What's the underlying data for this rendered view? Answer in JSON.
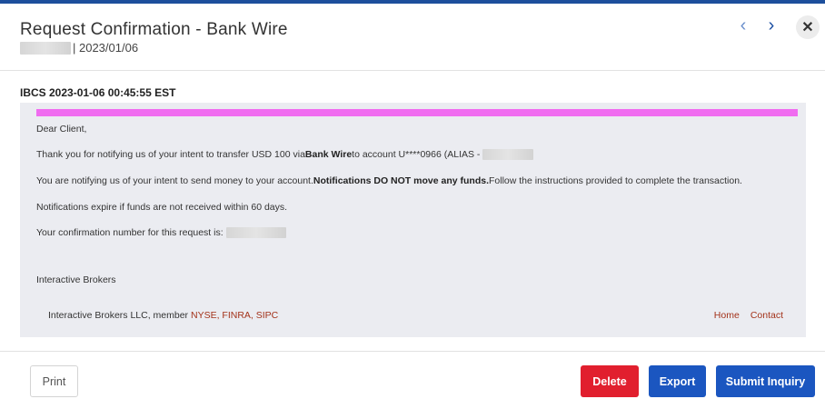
{
  "header": {
    "title": "Request Confirmation - Bank Wire",
    "date": "| 2023/01/06"
  },
  "message": {
    "heading": "IBCS 2023-01-06 00:45:55 EST",
    "greeting": "Dear Client,",
    "line1_pre": "Thank you for notifying us of your intent to transfer USD 100 via ",
    "line1_bold": "Bank Wire",
    "line1_post": " to account U****0966 (ALIAS -",
    "line2_pre": "You are notifying us of your intent to send money to your account. ",
    "line2_bold": "Notifications DO NOT move any funds.",
    "line2_post": " Follow the instructions provided to complete the transaction.",
    "line3": "Notifications expire if funds are not received within 60 days.",
    "line4": "Your confirmation number for this request is:",
    "signature": "Interactive Brokers",
    "footer_pre": "Interactive Brokers LLC, member ",
    "footer_red": "NYSE, FINRA, SIPC",
    "link_home": "Home",
    "link_contact": "Contact"
  },
  "actions": {
    "print": "Print",
    "delete": "Delete",
    "export": "Export",
    "submit": "Submit Inquiry"
  },
  "icons": {
    "prev": "‹",
    "next": "›",
    "close": "✕"
  },
  "colors": {
    "brand_blue": "#1b56c0",
    "delete_red": "#e11f2e",
    "highlight_pink": "#f06cf0",
    "link_red": "#a3321a"
  }
}
